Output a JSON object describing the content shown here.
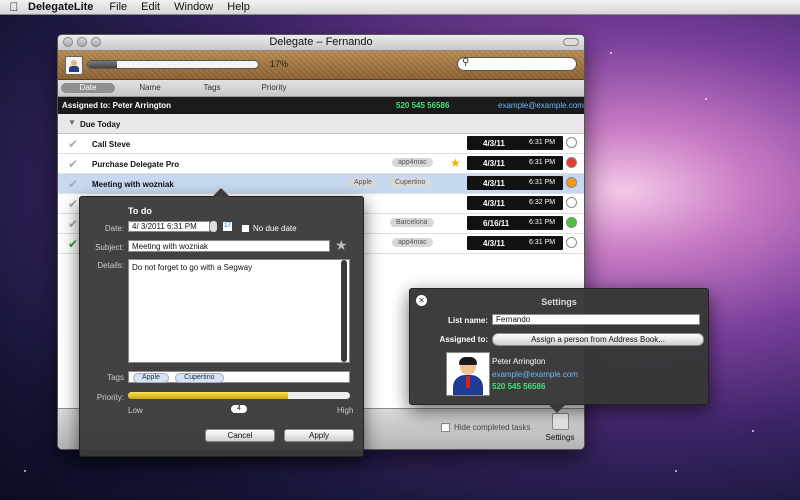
{
  "menubar": {
    "app_name": "DelegateLite",
    "items": [
      "File",
      "Edit",
      "Window",
      "Help"
    ]
  },
  "window": {
    "title": "Delegate – Fernando",
    "progress_percent": 17,
    "progress_label": "17%",
    "search_value": ""
  },
  "sort_tabs": [
    "Date",
    "Name",
    "Tags",
    "Priority"
  ],
  "active_sort": "Date",
  "assigned": {
    "label": "Assigned to: Peter Arrington",
    "phone": "520 545 56586",
    "email": "example@example.com"
  },
  "sections": [
    {
      "title": "Due Today"
    }
  ],
  "tasks": [
    {
      "title": "Call Steve",
      "tags": [],
      "date": "4/3/11",
      "time": "6:31 PM",
      "priority_color": "#ffffff",
      "done": false
    },
    {
      "title": "Purchase Delegate Pro",
      "tags": [
        "app4mac"
      ],
      "starred": true,
      "date": "4/3/11",
      "time": "6:31 PM",
      "priority_color": "#e23c2c",
      "done": false
    },
    {
      "title": "Meeting with wozniak",
      "tags": [
        "Apple",
        "Cupertino"
      ],
      "date": "4/3/11",
      "time": "6:31 PM",
      "priority_color": "#f39a1e",
      "done": false,
      "selected": true
    },
    {
      "title": "",
      "tags": [],
      "date": "4/3/11",
      "time": "6:32 PM",
      "priority_color": "#ffffff",
      "done": false
    },
    {
      "title": "",
      "tags": [
        "Barcelona"
      ],
      "date": "6/16/11",
      "time": "6:31 PM",
      "priority_color": "#4cc23a",
      "done": false
    },
    {
      "title": "",
      "tags": [
        "app4mac"
      ],
      "date": "4/3/11",
      "time": "6:31 PM",
      "priority_color": "#ffffff",
      "done": true
    }
  ],
  "bottombar": {
    "hide_completed": "Hide completed tasks",
    "settings_label": "Settings"
  },
  "todo": {
    "heading": "To do",
    "date_label": "Date:",
    "date_value": "4/ 3/2011   6:31 PM",
    "cal_icon": "17",
    "no_due": "No due date",
    "subject_label": "Subject:",
    "subject": "Meeting with wozniak",
    "details_label": "Details:",
    "details": "Do not forget to go with a Segway",
    "tags_label": "Tags",
    "tags": [
      "Apple",
      "Cupertino"
    ],
    "priority_label": "Priority:",
    "priority_value": "4",
    "priority_fraction": 0.72,
    "low": "Low",
    "high": "High",
    "cancel": "Cancel",
    "apply": "Apply"
  },
  "settings": {
    "heading": "Settings",
    "list_name_label": "List name:",
    "list_name": "Fernando",
    "assigned_label": "Assigned to:",
    "assign_button": "Assign a person from Address Book...",
    "person_name": "Peter Arrington",
    "person_email": "example@example.com",
    "person_phone": "520 545 56586"
  },
  "icons": {
    "apple": "apple-icon",
    "check": "check-icon",
    "star": "star-icon",
    "search": "search-icon",
    "close": "close-icon"
  }
}
